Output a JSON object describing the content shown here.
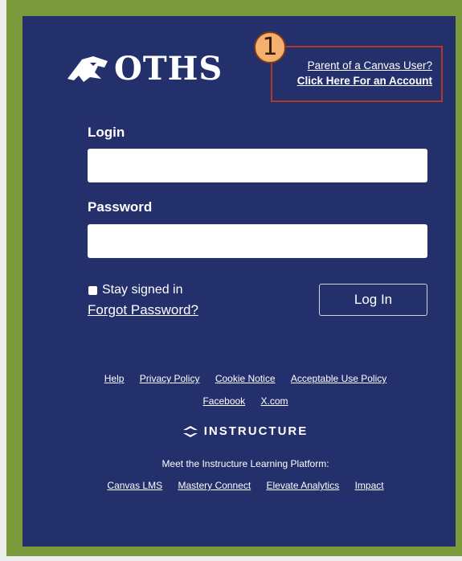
{
  "brand": {
    "logo_text": "OTHS"
  },
  "callout": {
    "number": "1"
  },
  "parent": {
    "line1": "Parent of a Canvas User?",
    "line2": "Click Here For an Account"
  },
  "form": {
    "login_label": "Login",
    "login_value": "",
    "password_label": "Password",
    "password_value": "",
    "stay_signed_in": "Stay signed in",
    "forgot_password": "Forgot Password?",
    "login_button": "Log In"
  },
  "footer": {
    "links_row1": [
      "Help",
      "Privacy Policy",
      "Cookie Notice",
      "Acceptable Use Policy"
    ],
    "links_row2": [
      "Facebook",
      "X.com"
    ],
    "brand": "INSTRUCTURE",
    "platform_text": "Meet the Instructure Learning Platform:",
    "platform_links": [
      "Canvas LMS",
      "Mastery Connect",
      "Elevate Analytics",
      "Impact"
    ]
  },
  "colors": {
    "card_bg": "#24306b",
    "frame_bg": "#7a9a3c",
    "callout_border": "#b03a25",
    "badge_bg": "#f3b06e"
  }
}
